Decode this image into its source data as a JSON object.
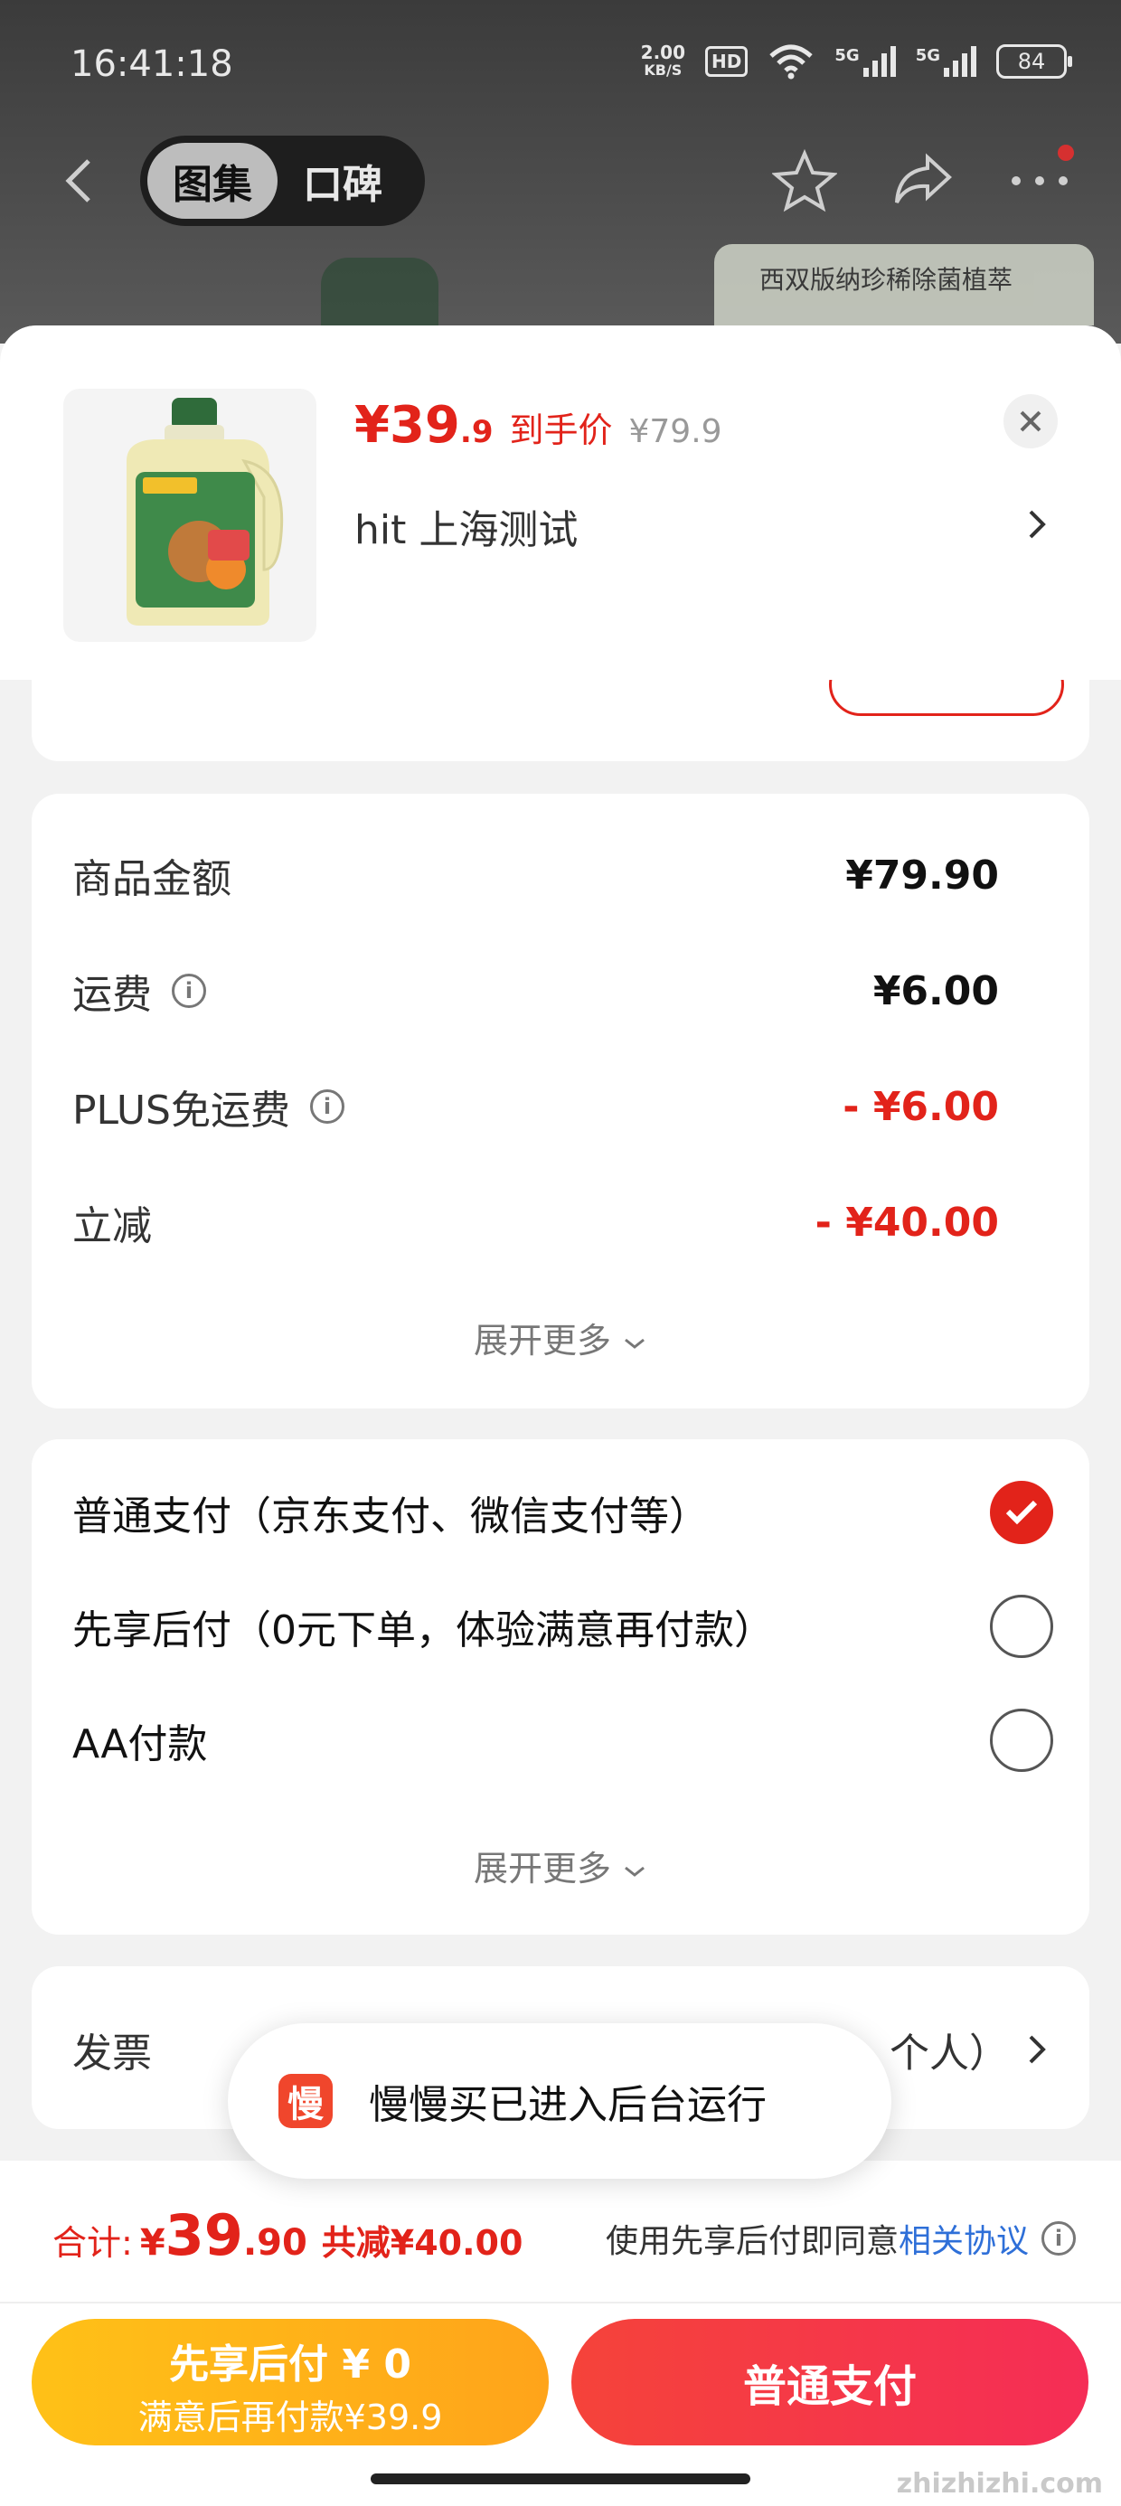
{
  "status_bar": {
    "time": "16:41:18",
    "net_speed_value": "2.00",
    "net_speed_unit": "KB/S",
    "hd_label": "HD",
    "sim1": "5G",
    "sim2": "5G",
    "battery": "84"
  },
  "nav": {
    "tabs": [
      {
        "label": "图集",
        "active": true
      },
      {
        "label": "口碑",
        "active": false
      }
    ]
  },
  "background_banner": "西双版纳珍稀除菌植萃",
  "product": {
    "price_int": "¥39",
    "price_dec": ".9",
    "price_tag": "到手价",
    "original_price": "¥79.9",
    "spec": "hit  上海测试",
    "image_alt": "立白卫仕 洗衣液"
  },
  "summary": {
    "rows": [
      {
        "label": "商品金额",
        "value": "¥79.90",
        "info": false,
        "red": false
      },
      {
        "label": "运费",
        "value": "¥6.00",
        "info": true,
        "red": false
      },
      {
        "label": "PLUS免运费",
        "value": "- ¥6.00",
        "info": true,
        "red": true
      },
      {
        "label": "立减",
        "value": "- ¥40.00",
        "info": false,
        "red": true
      }
    ],
    "expand_label": "展开更多"
  },
  "payment": {
    "options": [
      {
        "label": "普通支付（京东支付、微信支付等）",
        "checked": true
      },
      {
        "label": "先享后付（0元下单，体验满意再付款）",
        "checked": false
      },
      {
        "label": "AA付款",
        "checked": false
      }
    ],
    "expand_label": "展开更多"
  },
  "invoice": {
    "label": "发票",
    "value": "个人）"
  },
  "toast": {
    "icon_char": "慢",
    "text": "慢慢买已进入后台运行"
  },
  "footer": {
    "total_label": "合计:",
    "total_yuan": "¥",
    "total_int": "39",
    "total_dec": ".90",
    "saved": "共减¥40.00",
    "agree_text": "使用先享后付即同意",
    "agree_link": "相关协议",
    "bnpl_line1": "先享后付 ¥ 0",
    "bnpl_line2": "满意后再付款¥39.9",
    "pay_button": "普通支付",
    "watermark": "zhizhizhi.com"
  },
  "colors": {
    "accent_red": "#e2231a",
    "bnpl_yellow": "#ffb418",
    "link_blue": "#2e6fd8"
  }
}
